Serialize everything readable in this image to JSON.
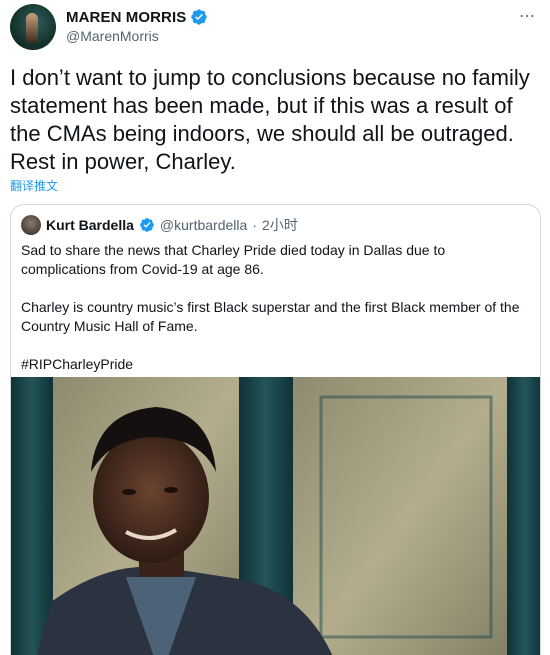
{
  "author": {
    "display_name": "MAREN MORRIS",
    "handle": "@MarenMorris",
    "avatar_icon": "profile-photo",
    "verified_icon": "verified-badge-icon"
  },
  "tweet": {
    "text": "I don’t want to jump to conclusions because no family statement has been made, but if this was a result of the CMAs being indoors, we should all be outraged. Rest in power, Charley.",
    "translate_label": "翻译推文",
    "more_label": "⋯"
  },
  "quoted_tweet": {
    "display_name": "Kurt Bardella",
    "handle": "@kurtbardella",
    "separator": "·",
    "time": "2小时",
    "paragraphs": [
      "Sad to share the news that Charley Pride died today in Dallas due to complications from Covid-19 at age 86.",
      "Charley is country music’s first Black superstar and the first Black member of the Country Music Hall of Fame."
    ],
    "hashtag": "#RIPCharleyPride",
    "photo_icon": "portrait-photo"
  },
  "colors": {
    "accent": "#1d9bf0",
    "text": "#0f1419",
    "secondary": "#536471",
    "border": "#cfd9de"
  }
}
